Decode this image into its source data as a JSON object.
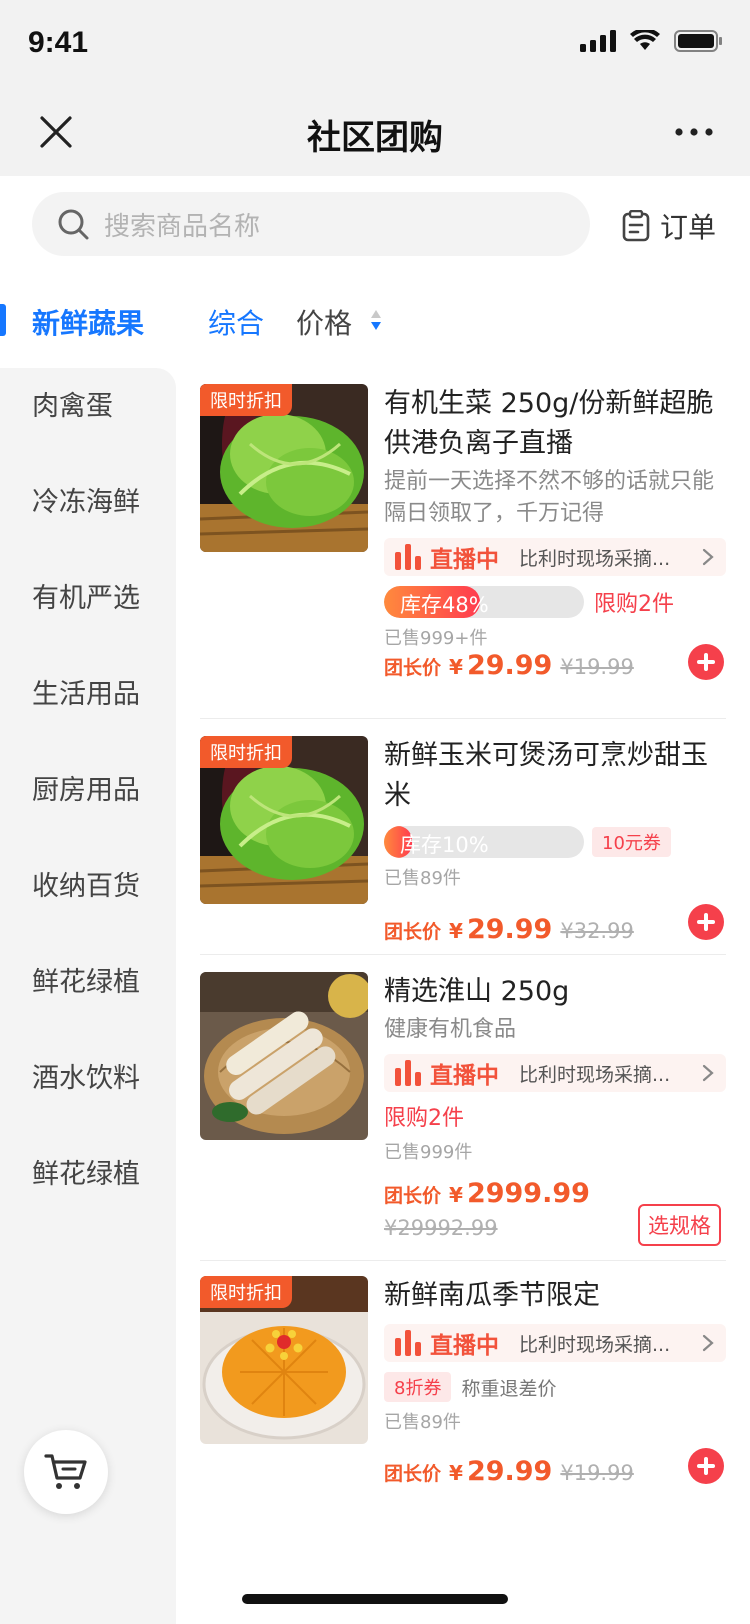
{
  "status_bar": {
    "time": "9:41"
  },
  "nav": {
    "title": "社区团购"
  },
  "search": {
    "placeholder": "搜索商品名称"
  },
  "orders": {
    "label": "订单"
  },
  "categories": {
    "active": "新鲜蔬果",
    "items": [
      "肉禽蛋",
      "冷冻海鲜",
      "有机严选",
      "生活用品",
      "厨房用品",
      "收纳百货",
      "鲜花绿植",
      "酒水饮料",
      "鲜花绿植"
    ]
  },
  "sort": {
    "comprehensive": "综合",
    "price": "价格"
  },
  "colors": {
    "accent": "#1677ff",
    "price": "#f25a2b",
    "red": "#f5404b"
  },
  "products": [
    {
      "tag": "限时折扣",
      "title": "有机生菜 250g/份新鲜超脆供港负离子直播",
      "desc": "提前一天选择不然不够的话就只能隔日领取了，千万记得",
      "live_label": "直播中",
      "live_desc": "比利时现场采摘...",
      "stock_label": "库存48%",
      "stock_percent": 48,
      "limit": "限购2件",
      "sold": "已售999+件",
      "price_label": "团长价",
      "price": "29.99",
      "original": "¥19.99"
    },
    {
      "tag": "限时折扣",
      "title": "新鲜玉米可煲汤可烹炒甜玉米",
      "stock_label": "库存10%",
      "stock_percent": 10,
      "coupon": "10元券",
      "sold": "已售89件",
      "price_label": "团长价",
      "price": "29.99",
      "original": "¥32.99"
    },
    {
      "title": "精选淮山 250g",
      "desc": "健康有机食品",
      "live_label": "直播中",
      "live_desc": "比利时现场采摘...",
      "limit": "限购2件",
      "sold": "已售999件",
      "price_label": "团长价",
      "price": "2999.99",
      "original": "¥29992.99",
      "spec_button": "选规格"
    },
    {
      "tag": "限时折扣",
      "title": "新鲜南瓜季节限定",
      "live_label": "直播中",
      "live_desc": "比利时现场采摘...",
      "coupon": "8折券",
      "weight_note": "称重退差价",
      "sold": "已售89件",
      "price_label": "团长价",
      "price": "29.99",
      "original": "¥19.99"
    }
  ],
  "currency": "¥"
}
